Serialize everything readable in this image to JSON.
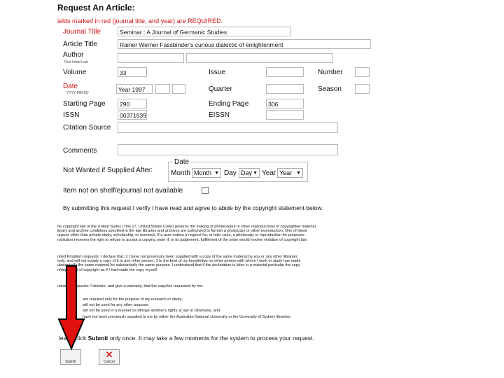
{
  "form": {
    "title": "Request An Article:",
    "required_note": "ields marked in red (journal title, and year) are REQUIRED.",
    "journal_title": {
      "label": "Journal Title",
      "value": "Seminar : A Journal of Germanic Studies"
    },
    "article_title": {
      "label": "Article Title",
      "value": "Rainer Werner Fassbinder's curious dialectic of enlightenment"
    },
    "author": {
      "label": "Author",
      "hint": "First Initial  Last"
    },
    "volume": {
      "label": "Volume",
      "value": "33"
    },
    "issue": {
      "label": "Issue"
    },
    "number": {
      "label": "Number"
    },
    "date": {
      "label": "Date",
      "hint": "YYYY MM DD",
      "year_value": "Year 1997"
    },
    "quarter": {
      "label": "Quarter"
    },
    "season": {
      "label": "Season"
    },
    "starting_page": {
      "label": "Starting Page",
      "value": "290"
    },
    "ending_page": {
      "label": "Ending Page",
      "value": "306"
    },
    "issn": {
      "label": "ISSN",
      "value": "00371939"
    },
    "eissn": {
      "label": "EISSN"
    },
    "citation_source": {
      "label": "Citation Source"
    },
    "comments": {
      "label": "Comments"
    },
    "not_wanted": {
      "label": "Not Wanted if Supplied After:",
      "legend": "Date",
      "month_label": "Month",
      "month_value": "Month",
      "day_label": "Day",
      "day_value": "Day",
      "year_label": "Year",
      "year_value": "Year"
    },
    "shelf": {
      "label": "Item not on shelf/ejournal not available"
    },
    "verify": "By submitting this request I verify I have read and agree to abide by the copyright statement below."
  },
  "copyright": {
    "p1": [
      "he copyright law of the United States (Title 17, United States Code) governs the making of photocopies or other reproductions of copyrighted material.",
      "ibrary and archive conditions specified in the law libraries and archives are authorized to furnish a photocopy or other reproduction. One of these",
      "urpose other than private study, scholarship, or research. If a user makes a request for, or later uses, a photocopy or reproduction for purposes",
      "nstitution reserves the right to refuse to accept a copying order if, in its judgement, fulfillment of the order would involve violation of copyright law."
    ],
    "p2": [
      "nited Kingdom requests: I declare that: 1 I have not previously been supplied with a copy of the same material by you or any other librarian;",
      "tudy, and will not supply a copy of it to any other person; 3 to the best of my knowledge no other person with whom I work or study has made",
      "ubstantially the same material for substantially the same purpose. I understand that if the declaration is false in a material particular the copy",
      "nfringement of copyright as if I had made the copy myself."
    ],
    "p3": "ustralian requests: I declare, and give a warranty, that the copy/ies requested by me:",
    "p4": [
      "are required only for the purpose of my research or study;",
      "will not be used for any other purpose;",
      "will not be used in a manner to infringe another's rights at law or otherwise, and",
      "have not been previously supplied to me by either the Australian National University or the University of Sydney libraries."
    ]
  },
  "submit_note": {
    "lead": "lease click ",
    "bold": "Submit",
    "rest": " only once. It may take a few moments for the system to process your request."
  },
  "buttons": {
    "submit": "Submit",
    "cancel": "Cancel"
  },
  "colors": {
    "required": "#d01010",
    "arrow": "#e01010",
    "arrow_outline": "#000000",
    "cancel_x": "#d42020"
  }
}
